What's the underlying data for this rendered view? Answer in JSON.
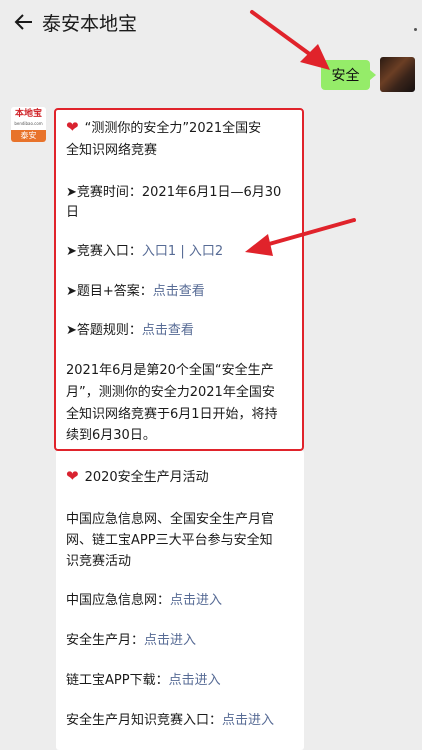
{
  "header": {
    "title": "泰安本地宝"
  },
  "colors": {
    "highlight": "#e0232b",
    "bubble": "#95ec69",
    "link": "#576b95"
  },
  "outgoing": {
    "text": "安全"
  },
  "sender": {
    "logo_text": "本地宝",
    "logo_site": "bendibao.com",
    "logo_city": "泰安"
  },
  "card1": {
    "title_l1": "“测测你的安全力”2021全国安",
    "title_l2": "全知识网络竞赛",
    "time_l1": "➤竞赛时间：2021年6月1日—6月30",
    "time_l2": "日",
    "entry_label": "➤竞赛入口：",
    "entry_link1": "入口1",
    "entry_sep": " | ",
    "entry_link2": "入口2",
    "qa_label": "➤题目+答案：",
    "qa_link": "点击查看",
    "rules_label": "➤答题规则：",
    "rules_link": "点击查看",
    "desc_l1": "2021年6月是第20个全国“安全生产",
    "desc_l2": "月”，测测你的安全力2021年全国安",
    "desc_l3": "全知识网络竞赛于6月1日开始，将持",
    "desc_l4": "续到6月30日。"
  },
  "card2": {
    "title": "2020安全生产月活动",
    "intro_l1": "中国应急信息网、全国安全生产月官",
    "intro_l2": "网、链工宝APP三大平台参与安全知",
    "intro_l3": "识竞赛活动",
    "items": [
      {
        "label": "中国应急信息网：",
        "link": "点击进入"
      },
      {
        "label": "安全生产月：",
        "link": "点击进入"
      },
      {
        "label": "链工宝APP下载：",
        "link": "点击进入"
      },
      {
        "label": "安全生产月知识竞赛入口：",
        "link": "点击进入"
      }
    ]
  }
}
